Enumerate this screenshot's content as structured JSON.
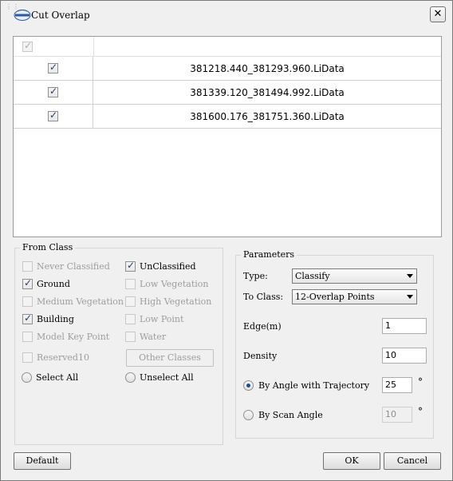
{
  "window": {
    "title": "Cut Overlap",
    "close_label": "✕"
  },
  "file_table": {
    "rows": [
      {
        "checked": true,
        "name": "381218.440_381293.960.LiData"
      },
      {
        "checked": true,
        "name": "381339.120_381494.992.LiData"
      },
      {
        "checked": true,
        "name": "381600.176_381751.360.LiData"
      }
    ]
  },
  "from_class": {
    "title": "From Class",
    "left": [
      {
        "label": "Never Classified",
        "checked": false,
        "enabled": false
      },
      {
        "label": "Ground",
        "checked": true,
        "enabled": true
      },
      {
        "label": "Medium Vegetation",
        "checked": false,
        "enabled": false
      },
      {
        "label": "Building",
        "checked": true,
        "enabled": true
      },
      {
        "label": "Model Key Point",
        "checked": false,
        "enabled": false
      },
      {
        "label": "Reserved10",
        "checked": false,
        "enabled": false
      }
    ],
    "right": [
      {
        "label": "UnClassified",
        "checked": true,
        "enabled": true
      },
      {
        "label": "Low Vegetation",
        "checked": false,
        "enabled": false
      },
      {
        "label": "High Vegetation",
        "checked": false,
        "enabled": false
      },
      {
        "label": "Low Point",
        "checked": false,
        "enabled": false
      },
      {
        "label": "Water",
        "checked": false,
        "enabled": false
      }
    ],
    "other_classes_label": "Other Classes",
    "select_all_label": "Select All",
    "unselect_all_label": "Unselect All"
  },
  "parameters": {
    "title": "Parameters",
    "type_label": "Type:",
    "type_value": "Classify",
    "to_class_label": "To Class:",
    "to_class_value": "12-Overlap Points",
    "edge_label": "Edge(m)",
    "edge_value": "1",
    "density_label": "Density",
    "density_value": "10",
    "angle_trajectory_label": "By Angle with Trajectory",
    "angle_trajectory_value": "25",
    "angle_trajectory_selected": true,
    "scan_angle_label": "By Scan Angle",
    "scan_angle_value": "10",
    "scan_angle_selected": false,
    "degree_symbol": "°"
  },
  "footer": {
    "default_label": "Default",
    "ok_label": "OK",
    "cancel_label": "Cancel"
  },
  "colors": {
    "accent": "#1b4d8f",
    "disabled_text": "#9d9d9d"
  },
  "icons": {
    "app_logo": "lidar-logo-icon",
    "close": "close-icon"
  }
}
